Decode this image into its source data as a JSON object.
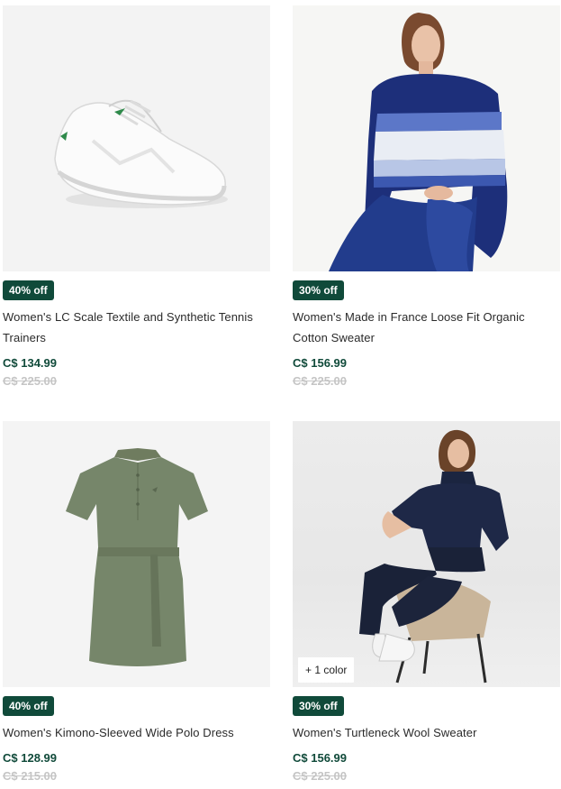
{
  "products": [
    {
      "badge": "40% off",
      "title": "Women's LC Scale Textile and Synthetic Tennis Trainers",
      "price": "C$ 134.99",
      "original_price": "C$ 225.00",
      "image": "white-tennis-trainer"
    },
    {
      "badge": "30% off",
      "title": "Women's Made in France Loose Fit Organic Cotton Sweater",
      "price": "C$ 156.99",
      "original_price": "C$ 225.00",
      "image": "blue-striped-sweater-model"
    },
    {
      "badge": "40% off",
      "title": "Women's Kimono-Sleeved Wide Polo Dress",
      "price": "C$ 128.99",
      "original_price": "C$ 215.00",
      "image": "khaki-polo-dress"
    },
    {
      "badge": "30% off",
      "title": "Women's Turtleneck Wool Sweater",
      "price": "C$ 156.99",
      "original_price": "C$ 225.00",
      "image": "navy-turtleneck-model",
      "more_colors": "+ 1 color"
    }
  ],
  "colors": {
    "badge": "#104a3a",
    "price": "#104a3a",
    "original_price": "#c5c5c5"
  }
}
